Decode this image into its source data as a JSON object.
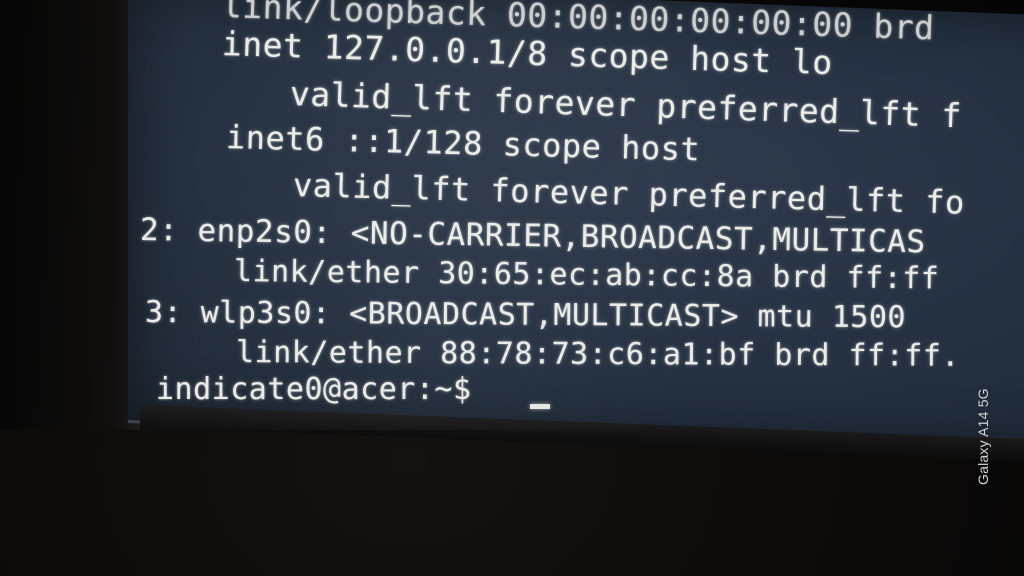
{
  "terminal": {
    "lines": [
      "link/loopback 00:00:00:00:00:00 brd",
      "inet 127.0.0.1/8 scope host lo",
      "valid_lft forever preferred_lft f",
      "inet6 ::1/128 scope host",
      "valid_lft forever preferred_lft fo",
      "2: enp2s0: <NO-CARRIER,BROADCAST,MULTICAS",
      "link/ether 30:65:ec:ab:cc:8a brd ff:ff",
      "3: wlp3s0: <BROADCAST,MULTICAST> mtu 1500",
      "link/ether 88:78:73:c6:a1:bf brd ff:ff.",
      "indicate0@acer:~$"
    ]
  },
  "camera_watermark": "Galaxy A14 5G"
}
